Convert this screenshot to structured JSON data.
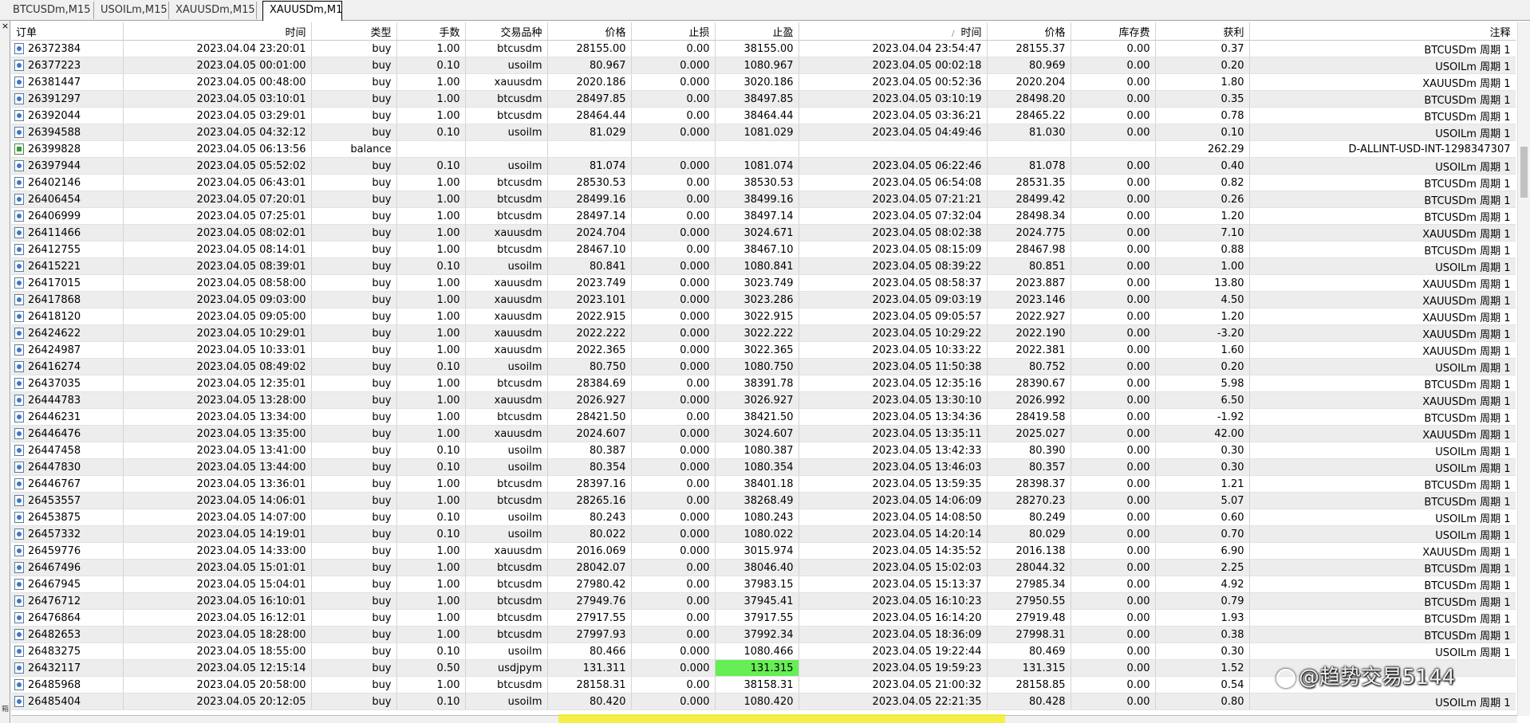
{
  "tabs": [
    "BTCUSDm,M15",
    "USOILm,M15",
    "XAUUSDm,M15",
    "XAUUSDm,M1"
  ],
  "active_tab": "XAUUSDm,M1",
  "window": {
    "close_icon": "close-icon",
    "close_glyph": "×",
    "toolbox_label": "箱"
  },
  "watermark": "@趋势交易5144",
  "columns": [
    "订单",
    "时间",
    "类型",
    "手数",
    "交易品种",
    "价格",
    "止损",
    "止盈",
    "时间",
    "价格",
    "库存费",
    "获利",
    "注释"
  ],
  "sort_indicator": "/",
  "colors": {
    "row_alt": "#ededed",
    "highlight": "#66ee55"
  },
  "rows": [
    {
      "order": "26372384",
      "open_time": "2023.04.04 23:20:01",
      "type": "buy",
      "lots": "1.00",
      "symbol": "btcusdm",
      "open_price": "28155.00",
      "sl": "0.00",
      "tp": "38155.00",
      "close_time": "2023.04.04 23:54:47",
      "close_price": "28155.37",
      "swap": "0.00",
      "profit": "0.37",
      "comment": "BTCUSDm 周期 1"
    },
    {
      "order": "26377223",
      "open_time": "2023.04.05 00:01:00",
      "type": "buy",
      "lots": "0.10",
      "symbol": "usoilm",
      "open_price": "80.967",
      "sl": "0.000",
      "tp": "1080.967",
      "close_time": "2023.04.05 00:02:18",
      "close_price": "80.969",
      "swap": "0.00",
      "profit": "0.20",
      "comment": "USOILm 周期 1"
    },
    {
      "order": "26381447",
      "open_time": "2023.04.05 00:48:00",
      "type": "buy",
      "lots": "1.00",
      "symbol": "xauusdm",
      "open_price": "2020.186",
      "sl": "0.000",
      "tp": "3020.186",
      "close_time": "2023.04.05 00:52:36",
      "close_price": "2020.204",
      "swap": "0.00",
      "profit": "1.80",
      "comment": "XAUUSDm 周期 1"
    },
    {
      "order": "26391297",
      "open_time": "2023.04.05 03:10:01",
      "type": "buy",
      "lots": "1.00",
      "symbol": "btcusdm",
      "open_price": "28497.85",
      "sl": "0.00",
      "tp": "38497.85",
      "close_time": "2023.04.05 03:10:19",
      "close_price": "28498.20",
      "swap": "0.00",
      "profit": "0.35",
      "comment": "BTCUSDm 周期 1"
    },
    {
      "order": "26392044",
      "open_time": "2023.04.05 03:29:01",
      "type": "buy",
      "lots": "1.00",
      "symbol": "btcusdm",
      "open_price": "28464.44",
      "sl": "0.00",
      "tp": "38464.44",
      "close_time": "2023.04.05 03:36:21",
      "close_price": "28465.22",
      "swap": "0.00",
      "profit": "0.78",
      "comment": "BTCUSDm 周期 1"
    },
    {
      "order": "26394588",
      "open_time": "2023.04.05 04:32:12",
      "type": "buy",
      "lots": "0.10",
      "symbol": "usoilm",
      "open_price": "81.029",
      "sl": "0.000",
      "tp": "1081.029",
      "close_time": "2023.04.05 04:49:46",
      "close_price": "81.030",
      "swap": "0.00",
      "profit": "0.10",
      "comment": "USOILm 周期 1"
    },
    {
      "order": "26399828",
      "open_time": "2023.04.05 06:13:56",
      "type": "balance",
      "lots": "",
      "symbol": "",
      "open_price": "",
      "sl": "",
      "tp": "",
      "close_time": "",
      "close_price": "",
      "swap": "",
      "profit": "262.29",
      "comment": "D-ALLINT-USD-INT-1298347307",
      "kind": "balance"
    },
    {
      "order": "26397944",
      "open_time": "2023.04.05 05:52:02",
      "type": "buy",
      "lots": "0.10",
      "symbol": "usoilm",
      "open_price": "81.074",
      "sl": "0.000",
      "tp": "1081.074",
      "close_time": "2023.04.05 06:22:46",
      "close_price": "81.078",
      "swap": "0.00",
      "profit": "0.40",
      "comment": "USOILm 周期 1"
    },
    {
      "order": "26402146",
      "open_time": "2023.04.05 06:43:01",
      "type": "buy",
      "lots": "1.00",
      "symbol": "btcusdm",
      "open_price": "28530.53",
      "sl": "0.00",
      "tp": "38530.53",
      "close_time": "2023.04.05 06:54:08",
      "close_price": "28531.35",
      "swap": "0.00",
      "profit": "0.82",
      "comment": "BTCUSDm 周期 1"
    },
    {
      "order": "26406454",
      "open_time": "2023.04.05 07:20:01",
      "type": "buy",
      "lots": "1.00",
      "symbol": "btcusdm",
      "open_price": "28499.16",
      "sl": "0.00",
      "tp": "38499.16",
      "close_time": "2023.04.05 07:21:21",
      "close_price": "28499.42",
      "swap": "0.00",
      "profit": "0.26",
      "comment": "BTCUSDm 周期 1"
    },
    {
      "order": "26406999",
      "open_time": "2023.04.05 07:25:01",
      "type": "buy",
      "lots": "1.00",
      "symbol": "btcusdm",
      "open_price": "28497.14",
      "sl": "0.00",
      "tp": "38497.14",
      "close_time": "2023.04.05 07:32:04",
      "close_price": "28498.34",
      "swap": "0.00",
      "profit": "1.20",
      "comment": "BTCUSDm 周期 1"
    },
    {
      "order": "26411466",
      "open_time": "2023.04.05 08:02:01",
      "type": "buy",
      "lots": "1.00",
      "symbol": "xauusdm",
      "open_price": "2024.704",
      "sl": "0.000",
      "tp": "3024.671",
      "close_time": "2023.04.05 08:02:38",
      "close_price": "2024.775",
      "swap": "0.00",
      "profit": "7.10",
      "comment": "XAUUSDm 周期 1"
    },
    {
      "order": "26412755",
      "open_time": "2023.04.05 08:14:01",
      "type": "buy",
      "lots": "1.00",
      "symbol": "btcusdm",
      "open_price": "28467.10",
      "sl": "0.00",
      "tp": "38467.10",
      "close_time": "2023.04.05 08:15:09",
      "close_price": "28467.98",
      "swap": "0.00",
      "profit": "0.88",
      "comment": "BTCUSDm 周期 1"
    },
    {
      "order": "26415221",
      "open_time": "2023.04.05 08:39:01",
      "type": "buy",
      "lots": "0.10",
      "symbol": "usoilm",
      "open_price": "80.841",
      "sl": "0.000",
      "tp": "1080.841",
      "close_time": "2023.04.05 08:39:22",
      "close_price": "80.851",
      "swap": "0.00",
      "profit": "1.00",
      "comment": "USOILm 周期 1"
    },
    {
      "order": "26417015",
      "open_time": "2023.04.05 08:58:00",
      "type": "buy",
      "lots": "1.00",
      "symbol": "xauusdm",
      "open_price": "2023.749",
      "sl": "0.000",
      "tp": "3023.749",
      "close_time": "2023.04.05 08:58:37",
      "close_price": "2023.887",
      "swap": "0.00",
      "profit": "13.80",
      "comment": "XAUUSDm 周期 1"
    },
    {
      "order": "26417868",
      "open_time": "2023.04.05 09:03:00",
      "type": "buy",
      "lots": "1.00",
      "symbol": "xauusdm",
      "open_price": "2023.101",
      "sl": "0.000",
      "tp": "3023.286",
      "close_time": "2023.04.05 09:03:19",
      "close_price": "2023.146",
      "swap": "0.00",
      "profit": "4.50",
      "comment": "XAUUSDm 周期 1"
    },
    {
      "order": "26418120",
      "open_time": "2023.04.05 09:05:00",
      "type": "buy",
      "lots": "1.00",
      "symbol": "xauusdm",
      "open_price": "2022.915",
      "sl": "0.000",
      "tp": "3022.915",
      "close_time": "2023.04.05 09:05:57",
      "close_price": "2022.927",
      "swap": "0.00",
      "profit": "1.20",
      "comment": "XAUUSDm 周期 1"
    },
    {
      "order": "26424622",
      "open_time": "2023.04.05 10:29:01",
      "type": "buy",
      "lots": "1.00",
      "symbol": "xauusdm",
      "open_price": "2022.222",
      "sl": "0.000",
      "tp": "3022.222",
      "close_time": "2023.04.05 10:29:22",
      "close_price": "2022.190",
      "swap": "0.00",
      "profit": "-3.20",
      "comment": "XAUUSDm 周期 1"
    },
    {
      "order": "26424987",
      "open_time": "2023.04.05 10:33:01",
      "type": "buy",
      "lots": "1.00",
      "symbol": "xauusdm",
      "open_price": "2022.365",
      "sl": "0.000",
      "tp": "3022.365",
      "close_time": "2023.04.05 10:33:22",
      "close_price": "2022.381",
      "swap": "0.00",
      "profit": "1.60",
      "comment": "XAUUSDm 周期 1"
    },
    {
      "order": "26416274",
      "open_time": "2023.04.05 08:49:02",
      "type": "buy",
      "lots": "0.10",
      "symbol": "usoilm",
      "open_price": "80.750",
      "sl": "0.000",
      "tp": "1080.750",
      "close_time": "2023.04.05 11:50:38",
      "close_price": "80.752",
      "swap": "0.00",
      "profit": "0.20",
      "comment": "USOILm 周期 1"
    },
    {
      "order": "26437035",
      "open_time": "2023.04.05 12:35:01",
      "type": "buy",
      "lots": "1.00",
      "symbol": "btcusdm",
      "open_price": "28384.69",
      "sl": "0.00",
      "tp": "38391.78",
      "close_time": "2023.04.05 12:35:16",
      "close_price": "28390.67",
      "swap": "0.00",
      "profit": "5.98",
      "comment": "BTCUSDm 周期 1"
    },
    {
      "order": "26444783",
      "open_time": "2023.04.05 13:28:00",
      "type": "buy",
      "lots": "1.00",
      "symbol": "xauusdm",
      "open_price": "2026.927",
      "sl": "0.000",
      "tp": "3026.927",
      "close_time": "2023.04.05 13:30:10",
      "close_price": "2026.992",
      "swap": "0.00",
      "profit": "6.50",
      "comment": "XAUUSDm 周期 1"
    },
    {
      "order": "26446231",
      "open_time": "2023.04.05 13:34:00",
      "type": "buy",
      "lots": "1.00",
      "symbol": "btcusdm",
      "open_price": "28421.50",
      "sl": "0.00",
      "tp": "38421.50",
      "close_time": "2023.04.05 13:34:36",
      "close_price": "28419.58",
      "swap": "0.00",
      "profit": "-1.92",
      "comment": "BTCUSDm 周期 1"
    },
    {
      "order": "26446476",
      "open_time": "2023.04.05 13:35:00",
      "type": "buy",
      "lots": "1.00",
      "symbol": "xauusdm",
      "open_price": "2024.607",
      "sl": "0.000",
      "tp": "3024.607",
      "close_time": "2023.04.05 13:35:11",
      "close_price": "2025.027",
      "swap": "0.00",
      "profit": "42.00",
      "comment": "XAUUSDm 周期 1"
    },
    {
      "order": "26447458",
      "open_time": "2023.04.05 13:41:00",
      "type": "buy",
      "lots": "0.10",
      "symbol": "usoilm",
      "open_price": "80.387",
      "sl": "0.000",
      "tp": "1080.387",
      "close_time": "2023.04.05 13:42:33",
      "close_price": "80.390",
      "swap": "0.00",
      "profit": "0.30",
      "comment": "USOILm 周期 1"
    },
    {
      "order": "26447830",
      "open_time": "2023.04.05 13:44:00",
      "type": "buy",
      "lots": "0.10",
      "symbol": "usoilm",
      "open_price": "80.354",
      "sl": "0.000",
      "tp": "1080.354",
      "close_time": "2023.04.05 13:46:03",
      "close_price": "80.357",
      "swap": "0.00",
      "profit": "0.30",
      "comment": "USOILm 周期 1"
    },
    {
      "order": "26446767",
      "open_time": "2023.04.05 13:36:01",
      "type": "buy",
      "lots": "1.00",
      "symbol": "btcusdm",
      "open_price": "28397.16",
      "sl": "0.00",
      "tp": "38401.18",
      "close_time": "2023.04.05 13:59:35",
      "close_price": "28398.37",
      "swap": "0.00",
      "profit": "1.21",
      "comment": "BTCUSDm 周期 1"
    },
    {
      "order": "26453557",
      "open_time": "2023.04.05 14:06:01",
      "type": "buy",
      "lots": "1.00",
      "symbol": "btcusdm",
      "open_price": "28265.16",
      "sl": "0.00",
      "tp": "38268.49",
      "close_time": "2023.04.05 14:06:09",
      "close_price": "28270.23",
      "swap": "0.00",
      "profit": "5.07",
      "comment": "BTCUSDm 周期 1"
    },
    {
      "order": "26453875",
      "open_time": "2023.04.05 14:07:00",
      "type": "buy",
      "lots": "0.10",
      "symbol": "usoilm",
      "open_price": "80.243",
      "sl": "0.000",
      "tp": "1080.243",
      "close_time": "2023.04.05 14:08:50",
      "close_price": "80.249",
      "swap": "0.00",
      "profit": "0.60",
      "comment": "USOILm 周期 1"
    },
    {
      "order": "26457332",
      "open_time": "2023.04.05 14:19:01",
      "type": "buy",
      "lots": "0.10",
      "symbol": "usoilm",
      "open_price": "80.022",
      "sl": "0.000",
      "tp": "1080.022",
      "close_time": "2023.04.05 14:20:14",
      "close_price": "80.029",
      "swap": "0.00",
      "profit": "0.70",
      "comment": "USOILm 周期 1"
    },
    {
      "order": "26459776",
      "open_time": "2023.04.05 14:33:00",
      "type": "buy",
      "lots": "1.00",
      "symbol": "xauusdm",
      "open_price": "2016.069",
      "sl": "0.000",
      "tp": "3015.974",
      "close_time": "2023.04.05 14:35:52",
      "close_price": "2016.138",
      "swap": "0.00",
      "profit": "6.90",
      "comment": "XAUUSDm 周期 1"
    },
    {
      "order": "26467496",
      "open_time": "2023.04.05 15:01:01",
      "type": "buy",
      "lots": "1.00",
      "symbol": "btcusdm",
      "open_price": "28042.07",
      "sl": "0.00",
      "tp": "38046.40",
      "close_time": "2023.04.05 15:02:03",
      "close_price": "28044.32",
      "swap": "0.00",
      "profit": "2.25",
      "comment": "BTCUSDm 周期 1"
    },
    {
      "order": "26467945",
      "open_time": "2023.04.05 15:04:01",
      "type": "buy",
      "lots": "1.00",
      "symbol": "btcusdm",
      "open_price": "27980.42",
      "sl": "0.00",
      "tp": "37983.15",
      "close_time": "2023.04.05 15:13:37",
      "close_price": "27985.34",
      "swap": "0.00",
      "profit": "4.92",
      "comment": "BTCUSDm 周期 1"
    },
    {
      "order": "26476712",
      "open_time": "2023.04.05 16:10:01",
      "type": "buy",
      "lots": "1.00",
      "symbol": "btcusdm",
      "open_price": "27949.76",
      "sl": "0.00",
      "tp": "37945.41",
      "close_time": "2023.04.05 16:10:23",
      "close_price": "27950.55",
      "swap": "0.00",
      "profit": "0.79",
      "comment": "BTCUSDm 周期 1"
    },
    {
      "order": "26476864",
      "open_time": "2023.04.05 16:12:01",
      "type": "buy",
      "lots": "1.00",
      "symbol": "btcusdm",
      "open_price": "27917.55",
      "sl": "0.00",
      "tp": "37917.55",
      "close_time": "2023.04.05 16:14:20",
      "close_price": "27919.48",
      "swap": "0.00",
      "profit": "1.93",
      "comment": "BTCUSDm 周期 1"
    },
    {
      "order": "26482653",
      "open_time": "2023.04.05 18:28:00",
      "type": "buy",
      "lots": "1.00",
      "symbol": "btcusdm",
      "open_price": "27997.93",
      "sl": "0.00",
      "tp": "37992.34",
      "close_time": "2023.04.05 18:36:09",
      "close_price": "27998.31",
      "swap": "0.00",
      "profit": "0.38",
      "comment": "BTCUSDm 周期 1"
    },
    {
      "order": "26483275",
      "open_time": "2023.04.05 18:55:00",
      "type": "buy",
      "lots": "0.10",
      "symbol": "usoilm",
      "open_price": "80.466",
      "sl": "0.000",
      "tp": "1080.466",
      "close_time": "2023.04.05 19:22:44",
      "close_price": "80.469",
      "swap": "0.00",
      "profit": "0.30",
      "comment": "USOILm 周期 1"
    },
    {
      "order": "26432117",
      "open_time": "2023.04.05 12:15:14",
      "type": "buy",
      "lots": "0.50",
      "symbol": "usdjpym",
      "open_price": "131.311",
      "sl": "0.000",
      "tp": "131.315",
      "close_time": "2023.04.05 19:59:23",
      "close_price": "131.315",
      "swap": "0.00",
      "profit": "1.52",
      "comment": "",
      "highlight_tp": true
    },
    {
      "order": "26485968",
      "open_time": "2023.04.05 20:58:00",
      "type": "buy",
      "lots": "1.00",
      "symbol": "btcusdm",
      "open_price": "28158.31",
      "sl": "0.00",
      "tp": "38158.31",
      "close_time": "2023.04.05 21:00:32",
      "close_price": "28158.85",
      "swap": "0.00",
      "profit": "0.54",
      "comment": ""
    },
    {
      "order": "26485404",
      "open_time": "2023.04.05 20:12:05",
      "type": "buy",
      "lots": "0.10",
      "symbol": "usoilm",
      "open_price": "80.420",
      "sl": "0.000",
      "tp": "1080.420",
      "close_time": "2023.04.05 22:21:35",
      "close_price": "80.428",
      "swap": "0.00",
      "profit": "0.80",
      "comment": "USOILm 周期 1"
    }
  ]
}
